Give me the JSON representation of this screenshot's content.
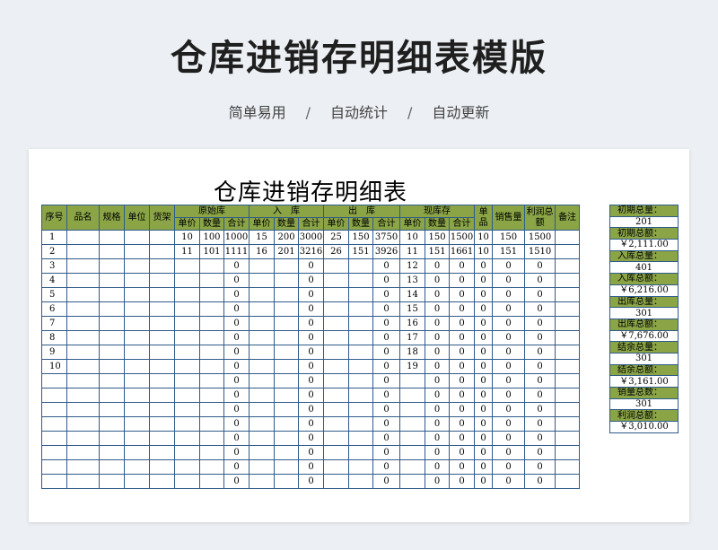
{
  "header": {
    "title": "仓库进销存明细表模版",
    "tags": [
      "简单易用",
      "自动统计",
      "自动更新"
    ],
    "separator": "/"
  },
  "sheet": {
    "title": "仓库进销存明细表",
    "group_headers": [
      "序号",
      "品名",
      "规格",
      "单位",
      "货架",
      "原始库",
      "入　库",
      "出　库",
      "现库存",
      "单品",
      "销售量",
      "利润总额",
      "备注"
    ],
    "sub_headers": [
      "单价",
      "数量",
      "合计",
      "单价",
      "数量",
      "合计",
      "单价",
      "数量",
      "合计",
      "单价",
      "数量",
      "合计"
    ],
    "rows": [
      [
        "1",
        "",
        "",
        "",
        "",
        "10",
        "100",
        "1000",
        "15",
        "200",
        "3000",
        "25",
        "150",
        "3750",
        "10",
        "150",
        "1500",
        "10",
        "150",
        "1500",
        ""
      ],
      [
        "2",
        "",
        "",
        "",
        "",
        "11",
        "101",
        "1111",
        "16",
        "201",
        "3216",
        "26",
        "151",
        "3926",
        "11",
        "151",
        "1661",
        "10",
        "151",
        "1510",
        ""
      ],
      [
        "3",
        "",
        "",
        "",
        "",
        "",
        "",
        "0",
        "",
        "",
        "0",
        "",
        "",
        "0",
        "12",
        "0",
        "0",
        "0",
        "0",
        "0",
        ""
      ],
      [
        "4",
        "",
        "",
        "",
        "",
        "",
        "",
        "0",
        "",
        "",
        "0",
        "",
        "",
        "0",
        "13",
        "0",
        "0",
        "0",
        "0",
        "0",
        ""
      ],
      [
        "5",
        "",
        "",
        "",
        "",
        "",
        "",
        "0",
        "",
        "",
        "0",
        "",
        "",
        "0",
        "14",
        "0",
        "0",
        "0",
        "0",
        "0",
        ""
      ],
      [
        "6",
        "",
        "",
        "",
        "",
        "",
        "",
        "0",
        "",
        "",
        "0",
        "",
        "",
        "0",
        "15",
        "0",
        "0",
        "0",
        "0",
        "0",
        ""
      ],
      [
        "7",
        "",
        "",
        "",
        "",
        "",
        "",
        "0",
        "",
        "",
        "0",
        "",
        "",
        "0",
        "16",
        "0",
        "0",
        "0",
        "0",
        "0",
        ""
      ],
      [
        "8",
        "",
        "",
        "",
        "",
        "",
        "",
        "0",
        "",
        "",
        "0",
        "",
        "",
        "0",
        "17",
        "0",
        "0",
        "0",
        "0",
        "0",
        ""
      ],
      [
        "9",
        "",
        "",
        "",
        "",
        "",
        "",
        "0",
        "",
        "",
        "0",
        "",
        "",
        "0",
        "18",
        "0",
        "0",
        "0",
        "0",
        "0",
        ""
      ],
      [
        "10",
        "",
        "",
        "",
        "",
        "",
        "",
        "0",
        "",
        "",
        "0",
        "",
        "",
        "0",
        "19",
        "0",
        "0",
        "0",
        "0",
        "0",
        ""
      ],
      [
        "",
        "",
        "",
        "",
        "",
        "",
        "",
        "0",
        "",
        "",
        "0",
        "",
        "",
        "0",
        "",
        "0",
        "0",
        "0",
        "0",
        "0",
        ""
      ],
      [
        "",
        "",
        "",
        "",
        "",
        "",
        "",
        "0",
        "",
        "",
        "0",
        "",
        "",
        "0",
        "",
        "0",
        "0",
        "0",
        "0",
        "0",
        ""
      ],
      [
        "",
        "",
        "",
        "",
        "",
        "",
        "",
        "0",
        "",
        "",
        "0",
        "",
        "",
        "0",
        "",
        "0",
        "0",
        "0",
        "0",
        "0",
        ""
      ],
      [
        "",
        "",
        "",
        "",
        "",
        "",
        "",
        "0",
        "",
        "",
        "0",
        "",
        "",
        "0",
        "",
        "0",
        "0",
        "0",
        "0",
        "0",
        ""
      ],
      [
        "",
        "",
        "",
        "",
        "",
        "",
        "",
        "0",
        "",
        "",
        "0",
        "",
        "",
        "0",
        "",
        "0",
        "0",
        "0",
        "0",
        "0",
        ""
      ],
      [
        "",
        "",
        "",
        "",
        "",
        "",
        "",
        "0",
        "",
        "",
        "0",
        "",
        "",
        "0",
        "",
        "0",
        "0",
        "0",
        "0",
        "0",
        ""
      ],
      [
        "",
        "",
        "",
        "",
        "",
        "",
        "",
        "0",
        "",
        "",
        "0",
        "",
        "",
        "0",
        "",
        "0",
        "0",
        "0",
        "0",
        "0",
        ""
      ],
      [
        "",
        "",
        "",
        "",
        "",
        "",
        "",
        "0",
        "",
        "",
        "0",
        "",
        "",
        "0",
        "",
        "0",
        "0",
        "0",
        "0",
        "0",
        ""
      ]
    ]
  },
  "summary": [
    {
      "label": "初期总量：",
      "value": "201"
    },
    {
      "label": "初期总额：",
      "value": "￥2,111.00"
    },
    {
      "label": "入库总量：",
      "value": "401"
    },
    {
      "label": "入库总额：",
      "value": "￥6,216.00"
    },
    {
      "label": "出库总量：",
      "value": "301"
    },
    {
      "label": "出库总额：",
      "value": "￥7,676.00"
    },
    {
      "label": "结余总量：",
      "value": "301"
    },
    {
      "label": "结余总额：",
      "value": "￥3,161.00"
    },
    {
      "label": "销量总数：",
      "value": "301"
    },
    {
      "label": "利润总额：",
      "value": "￥3,010.00"
    }
  ],
  "colors": {
    "header_green": "#8aa446",
    "grid_blue": "#2f5b8a",
    "page_background": "#eceff3"
  }
}
